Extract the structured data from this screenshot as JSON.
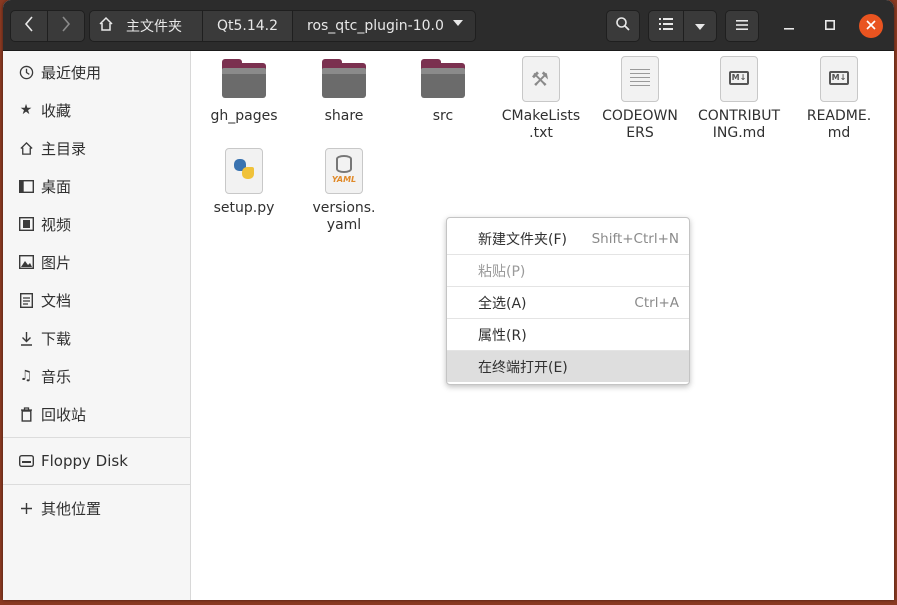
{
  "headerbar": {
    "breadcrumbs": [
      "主文件夹",
      "Qt5.14.2",
      "ros_qtc_plugin-10.0"
    ],
    "icons": {
      "back": "chevron-left-icon",
      "forward": "chevron-right-icon",
      "home": "home-icon",
      "search": "search-icon",
      "list_view": "list-view-icon",
      "view_options": "chevron-down-icon",
      "menu": "hamburger-menu-icon",
      "minimize": "minimize-icon",
      "maximize": "maximize-icon",
      "close": "close-icon"
    }
  },
  "sidebar": {
    "items": [
      {
        "label": "最近使用",
        "icon": "clock-icon"
      },
      {
        "label": "收藏",
        "icon": "star-icon"
      },
      {
        "label": "主目录",
        "icon": "home-icon"
      },
      {
        "label": "桌面",
        "icon": "desktop-icon"
      },
      {
        "label": "视频",
        "icon": "video-icon"
      },
      {
        "label": "图片",
        "icon": "picture-icon"
      },
      {
        "label": "文档",
        "icon": "document-icon"
      },
      {
        "label": "下载",
        "icon": "download-icon"
      },
      {
        "label": "音乐",
        "icon": "music-icon"
      },
      {
        "label": "回收站",
        "icon": "trash-icon"
      }
    ],
    "devices": [
      {
        "label": "Floppy Disk",
        "icon": "drive-icon"
      }
    ],
    "other": [
      {
        "label": "其他位置",
        "icon": "plus-icon"
      }
    ]
  },
  "files": [
    {
      "name": "gh_pages",
      "type": "folder"
    },
    {
      "name": "share",
      "type": "folder"
    },
    {
      "name": "src",
      "type": "folder"
    },
    {
      "name": "CMakeLists\n.txt",
      "type": "cmake"
    },
    {
      "name": "CODEOWN\nERS",
      "type": "text"
    },
    {
      "name": "CONTRIBUT\nING.md",
      "type": "markdown"
    },
    {
      "name": "README.\nmd",
      "type": "markdown"
    },
    {
      "name": "setup.py",
      "type": "python"
    },
    {
      "name": "versions.\nyaml",
      "type": "yaml"
    }
  ],
  "context_menu": {
    "items": [
      {
        "label": "新建文件夹(F)",
        "shortcut": "Shift+Ctrl+N",
        "enabled": true
      },
      {
        "label": "粘贴(P)",
        "shortcut": "",
        "enabled": false
      },
      {
        "label": "全选(A)",
        "shortcut": "Ctrl+A",
        "enabled": true
      },
      {
        "label": "属性(R)",
        "shortcut": "",
        "enabled": true
      },
      {
        "label": "在终端打开(E)",
        "shortcut": "",
        "enabled": true,
        "hovered": true
      }
    ]
  }
}
